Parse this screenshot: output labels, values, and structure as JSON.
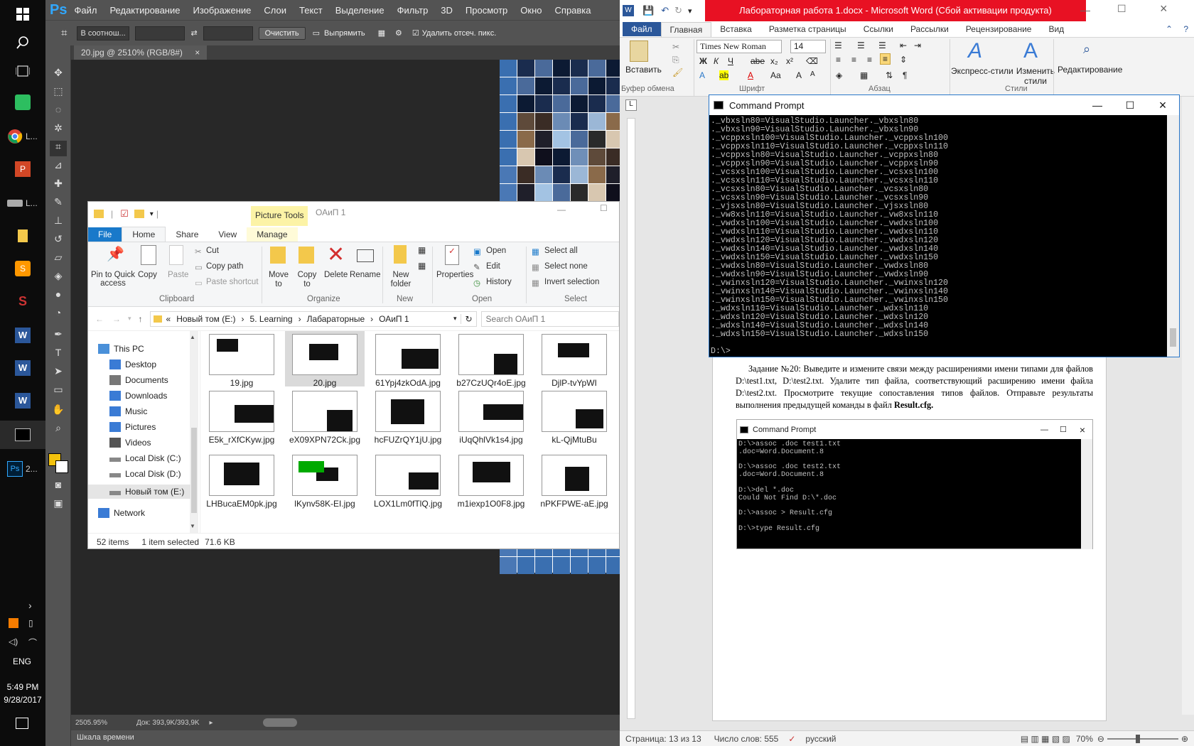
{
  "taskbar": {
    "items": [
      {
        "icon": "windows-start-icon",
        "label": ""
      },
      {
        "icon": "search-icon",
        "label": ""
      },
      {
        "icon": "task-view-icon",
        "label": ""
      },
      {
        "icon": "evernote-icon",
        "label": ""
      },
      {
        "icon": "chrome-icon",
        "label": "L..."
      },
      {
        "icon": "powerpoint-icon",
        "label": ""
      },
      {
        "icon": "drive-icon",
        "label": "L..."
      },
      {
        "icon": "file-explorer-icon",
        "label": ""
      },
      {
        "icon": "sublime-icon",
        "label": ""
      },
      {
        "icon": "red-app-icon",
        "label": ""
      },
      {
        "icon": "word-icon",
        "label": ""
      },
      {
        "icon": "word-icon",
        "label": ""
      },
      {
        "icon": "word-icon",
        "label": ""
      },
      {
        "icon": "cmd-icon",
        "label": ""
      },
      {
        "icon": "photoshop-icon",
        "label": "2..."
      }
    ],
    "lang": "ENG",
    "time": "5:49 PM",
    "date": "9/28/2017"
  },
  "photoshop": {
    "logo": "Ps",
    "menu": [
      "Файл",
      "Редактирование",
      "Изображение",
      "Слои",
      "Текст",
      "Выделение",
      "Фильтр",
      "3D",
      "Просмотр",
      "Окно",
      "Справка"
    ],
    "options": {
      "ratio": "В соотнош...",
      "clear": "Очистить",
      "straighten": "Выпрямить",
      "delete_cropped": "Удалить отсеч. пикс."
    },
    "tab": "20.jpg @ 2510% (RGB/8#)",
    "zoom": "2505.95%",
    "doc": "Док: 393,9K/393,9K",
    "timeline": "Шкала времени",
    "fg_color": "#f4c20d",
    "bg_color": "#ffffff"
  },
  "explorer": {
    "title": "ОАиП 1",
    "context_tab": "Picture Tools",
    "tabs": [
      "File",
      "Home",
      "Share",
      "View",
      "Manage"
    ],
    "ribbon": {
      "pin": "Pin to Quick access",
      "copy": "Copy",
      "paste": "Paste",
      "cut": "Cut",
      "copy_path": "Copy path",
      "paste_shortcut": "Paste shortcut",
      "clipboard": "Clipboard",
      "move_to": "Move to",
      "copy_to": "Copy to",
      "delete": "Delete",
      "rename": "Rename",
      "organize": "Organize",
      "new_folder": "New folder",
      "new": "New",
      "properties": "Properties",
      "open": "Open",
      "edit": "Edit",
      "history": "History",
      "open_group": "Open",
      "select_all": "Select all",
      "select_none": "Select none",
      "invert": "Invert selection",
      "select": "Select"
    },
    "breadcrumb": [
      "Новый том (E:)",
      "5. Learning",
      "Лабараторные",
      "ОАиП 1"
    ],
    "search_placeholder": "Search ОАиП 1",
    "nav": [
      {
        "label": "This PC",
        "icon": "this-pc-icon"
      },
      {
        "label": "Desktop",
        "icon": "desktop-icon"
      },
      {
        "label": "Documents",
        "icon": "documents-icon"
      },
      {
        "label": "Downloads",
        "icon": "downloads-icon"
      },
      {
        "label": "Music",
        "icon": "music-icon"
      },
      {
        "label": "Pictures",
        "icon": "pictures-icon"
      },
      {
        "label": "Videos",
        "icon": "videos-icon"
      },
      {
        "label": "Local Disk (C:)",
        "icon": "disk-icon"
      },
      {
        "label": "Local Disk (D:)",
        "icon": "disk-icon"
      },
      {
        "label": "Новый том (E:)",
        "icon": "disk-icon"
      },
      {
        "label": "Network",
        "icon": "network-icon"
      }
    ],
    "files": [
      [
        "19.jpg",
        "20.jpg",
        "61Ypj4zkOdA.jpg",
        "b27CzUQr4oE.jpg",
        "DjlP-tvYpWI"
      ],
      [
        "E5k_rXfCKyw.jpg",
        "eX09XPN72Ck.jpg",
        "hcFUZrQY1jU.jpg",
        "iUqQhlVk1s4.jpg",
        "kL-QjMtuBu"
      ],
      [
        "LHBucaEM0pk.jpg",
        "lKynv58K-EI.jpg",
        "LOX1Lm0fTlQ.jpg",
        "m1iexp1O0F8.jpg",
        "nPKFPWE-aE.jpg"
      ]
    ],
    "status_items": "52 items",
    "status_selected": "1 item selected",
    "status_size": "71.6 KB"
  },
  "word": {
    "title": "Лабораторная работа 1.docx - Microsoft Word (Сбой активации продукта)",
    "title_bg": "#e81123",
    "tabs": [
      "Файл",
      "Главная",
      "Вставка",
      "Разметка страницы",
      "Ссылки",
      "Рассылки",
      "Рецензирование",
      "Вид"
    ],
    "paste": "Вставить",
    "clipboard": "Буфер обмена",
    "font": "Times New Roman",
    "font_size": "14",
    "font_group": "Шрифт",
    "para_group": "Абзац",
    "styles_group": "Стили",
    "express_styles": "Экспресс-стили",
    "change_styles": "Изменить стили",
    "editing": "Редактирование",
    "paragraph": "Задание №20: Выведите и измените связи между расширениями имени типами для файлов D:\\test1.txt, D:\\test2.txt. Удалите тип файла, соответствующий расширению имени файла D:\\test2.txt. Просмотрите текущие сопоставления типов файлов. Отправьте результаты выполнения предыдущей команды в файл ",
    "paragraph_bold": "Result.cfg.",
    "status_page": "Страница: 13 из 13",
    "status_words": "Число слов: 555",
    "status_lang": "русский",
    "zoom": "70%"
  },
  "cmd_main": {
    "title": "Command Prompt",
    "lines": [
      "._vbxsln80=VisualStudio.Launcher._vbxsln80",
      "._vbxsln90=VisualStudio.Launcher._vbxsln90",
      "._vcppxsln100=VisualStudio.Launcher._vcppxsln100",
      "._vcppxsln110=VisualStudio.Launcher._vcppxsln110",
      "._vcppxsln80=VisualStudio.Launcher._vcppxsln80",
      "._vcppxsln90=VisualStudio.Launcher._vcppxsln90",
      "._vcsxsln100=VisualStudio.Launcher._vcsxsln100",
      "._vcsxsln110=VisualStudio.Launcher._vcsxsln110",
      "._vcsxsln80=VisualStudio.Launcher._vcsxsln80",
      "._vcsxsln90=VisualStudio.Launcher._vcsxsln90",
      "._vjsxsln80=VisualStudio.Launcher._vjsxsln80",
      "._vw8xsln110=VisualStudio.Launcher._vw8xsln110",
      "._vwdxsln100=VisualStudio.Launcher._vwdxsln100",
      "._vwdxsln110=VisualStudio.Launcher._vwdxsln110",
      "._vwdxsln120=VisualStudio.Launcher._vwdxsln120",
      "._vwdxsln140=VisualStudio.Launcher._vwdxsln140",
      "._vwdxsln150=VisualStudio.Launcher._vwdxsln150",
      "._vwdxsln80=VisualStudio.Launcher._vwdxsln80",
      "._vwdxsln90=VisualStudio.Launcher._vwdxsln90",
      "._vwinxsln120=VisualStudio.Launcher._vwinxsln120",
      "._vwinxsln140=VisualStudio.Launcher._vwinxsln140",
      "._vwinxsln150=VisualStudio.Launcher._vwinxsln150",
      "._wdxsln110=VisualStudio.Launcher._wdxsln110",
      "._wdxsln120=VisualStudio.Launcher._wdxsln120",
      "._wdxsln140=VisualStudio.Launcher._wdxsln140",
      "._wdxsln150=VisualStudio.Launcher._wdxsln150",
      "",
      "D:\\>"
    ]
  },
  "cmd_doc": {
    "title": "Command Prompt",
    "lines": [
      "D:\\>assoc .doc test1.txt",
      ".doc=Word.Document.8",
      "",
      "D:\\>assoc .doc test2.txt",
      ".doc=Word.Document.8",
      "",
      "D:\\>del *.doc",
      "Could Not Find D:\\*.doc",
      "",
      "D:\\>assoc > Result.cfg",
      "",
      "D:\\>type Result.cfg"
    ]
  }
}
